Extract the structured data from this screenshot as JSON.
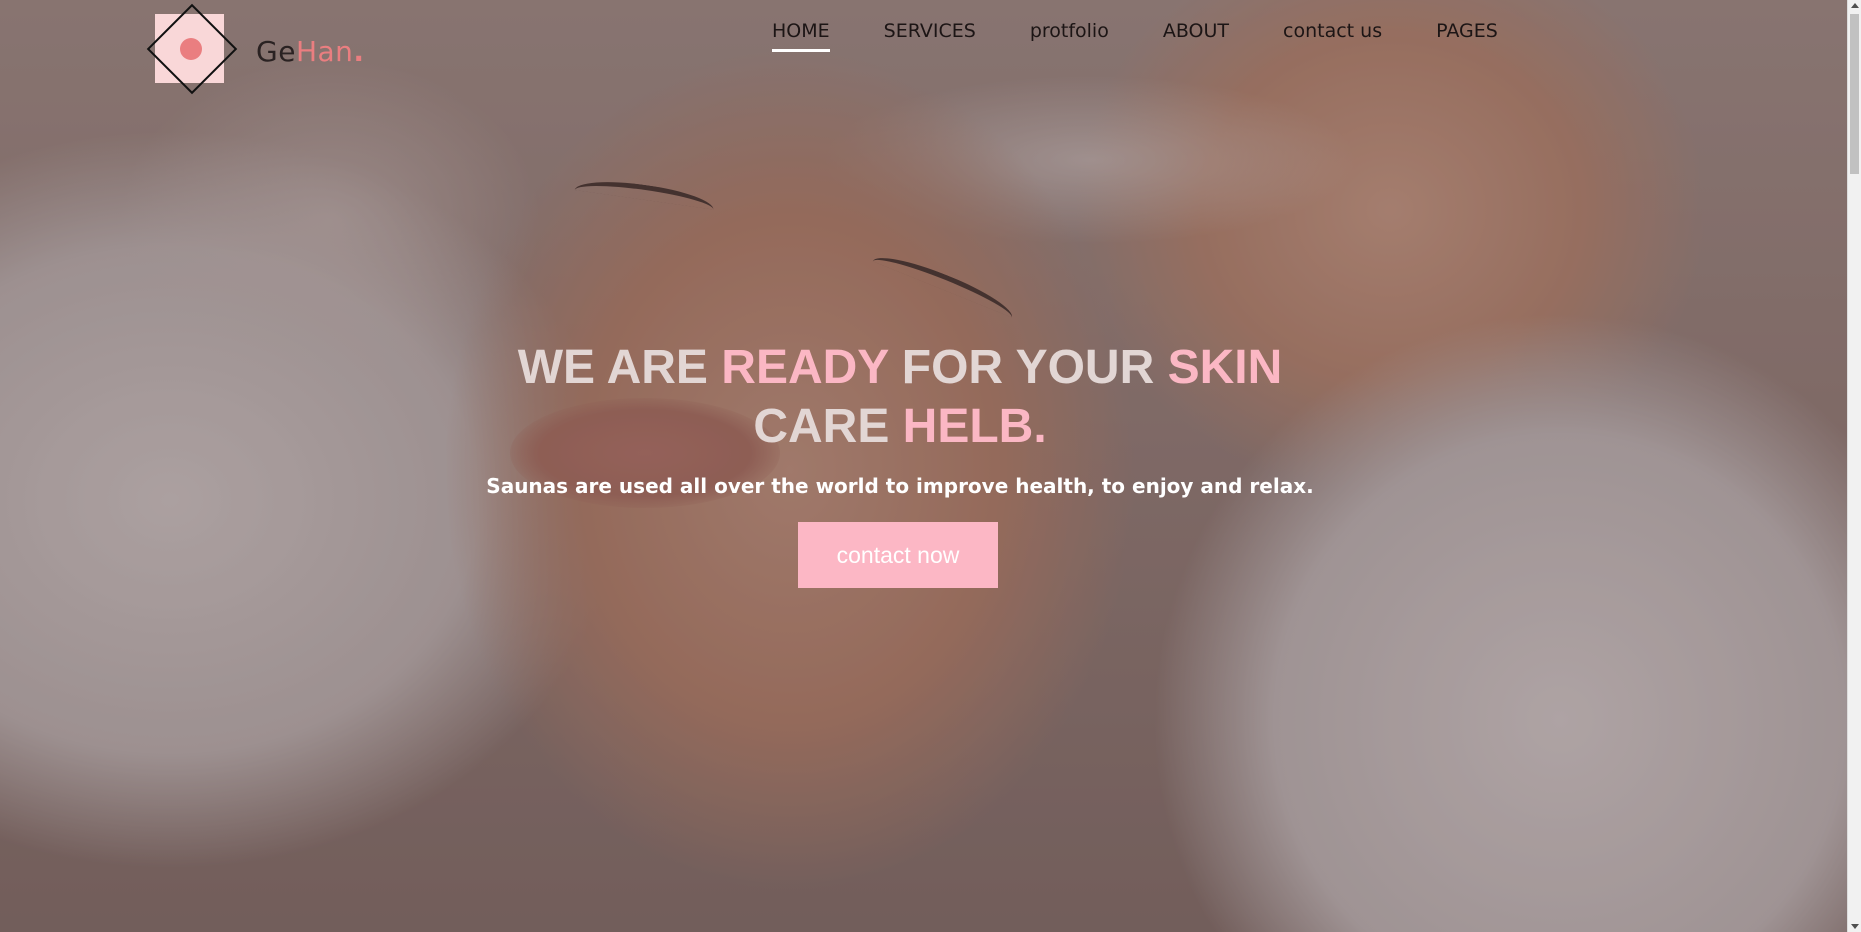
{
  "brand": {
    "name_part1": "Ge",
    "name_part2": "Han",
    "name_dot": ".",
    "logo_icon": "diamond-circle-logo-icon",
    "accent_color": "#ea7e80"
  },
  "nav": {
    "items": [
      {
        "label": "HOME",
        "active": true
      },
      {
        "label": "SERVICES",
        "active": false
      },
      {
        "label": "protfolio",
        "active": false
      },
      {
        "label": "ABOUT",
        "active": false
      },
      {
        "label": "contact us",
        "active": false
      },
      {
        "label": "PAGES",
        "active": false
      }
    ]
  },
  "hero": {
    "title_part1": "WE ARE ",
    "title_part2": "READY",
    "title_part3": " FOR YOUR ",
    "title_part4": "SKIN",
    "title_part5": "CARE ",
    "title_part6": "HELB.",
    "subtitle": "Saunas are used all over the world to improve health, to enjoy and relax.",
    "cta_label": "contact now",
    "highlight_color": "#fbb7c4",
    "cta_color": "#fcb7c5"
  }
}
